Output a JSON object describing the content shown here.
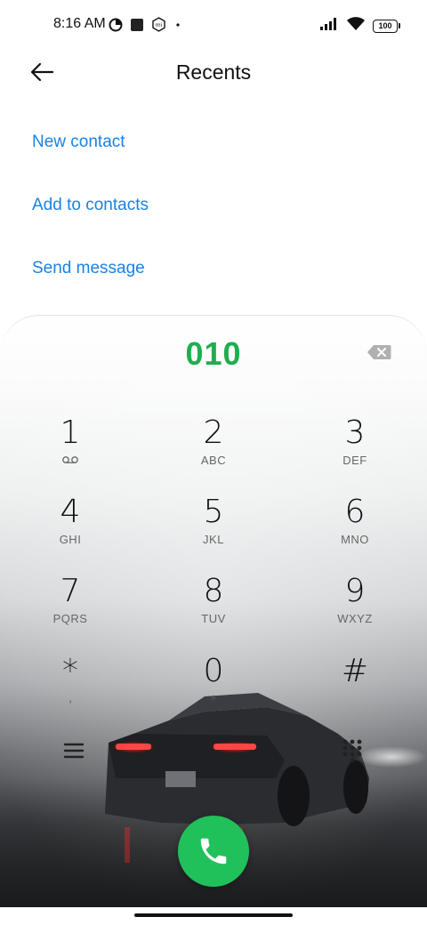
{
  "status_bar": {
    "time": "8:16 AM",
    "left_icons": [
      "data-saver-icon",
      "app-square-icon",
      "mi-badge-icon",
      "dot-icon"
    ],
    "right_icons": [
      "signal-icon",
      "wifi-icon",
      "battery-icon"
    ],
    "battery_level": "100"
  },
  "header": {
    "title": "Recents",
    "back_icon": "arrow-left-icon"
  },
  "actions": {
    "new_contact": "New contact",
    "add_to_contacts": "Add to contacts",
    "send_message": "Send message"
  },
  "dialpad": {
    "number": "010",
    "number_color": "#1fae4e",
    "backspace_icon": "backspace-icon",
    "keys": [
      {
        "digit": "1",
        "sub": ""
      },
      {
        "digit": "2",
        "sub": "ABC"
      },
      {
        "digit": "3",
        "sub": "DEF"
      },
      {
        "digit": "4",
        "sub": "GHI"
      },
      {
        "digit": "5",
        "sub": "JKL"
      },
      {
        "digit": "6",
        "sub": "MNO"
      },
      {
        "digit": "7",
        "sub": "PQRS"
      },
      {
        "digit": "8",
        "sub": "TUV"
      },
      {
        "digit": "9",
        "sub": "WXYZ"
      },
      {
        "digit": "*",
        "sub": ","
      },
      {
        "digit": "0",
        "sub": "+"
      },
      {
        "digit": "#",
        "sub": ""
      }
    ],
    "key1_icon": "voicemail-icon",
    "menu_icon": "menu-icon",
    "keypad_icon": "dialpad-icon",
    "call_icon": "phone-icon",
    "call_color": "#20c15a"
  },
  "colors": {
    "accent_link": "#1a82e2"
  }
}
